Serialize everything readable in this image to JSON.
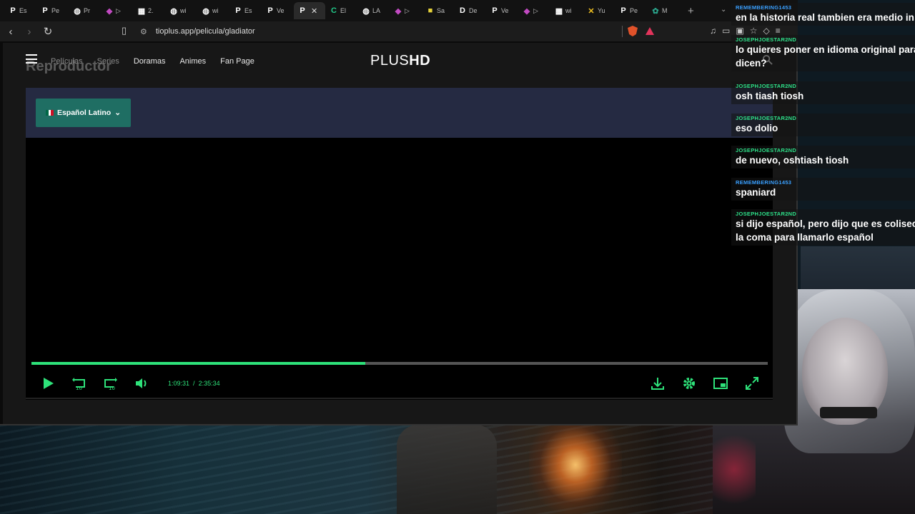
{
  "browser": {
    "tabs": [
      {
        "icon": "P",
        "label": "Es",
        "active": false
      },
      {
        "icon": "P",
        "label": "Pe",
        "active": false
      },
      {
        "icon": "globe",
        "label": "Pr",
        "active": false
      },
      {
        "icon": "twitch",
        "label": "▷",
        "active": false
      },
      {
        "icon": "calc",
        "label": "2.",
        "active": false
      },
      {
        "icon": "globe",
        "label": "wi",
        "active": false
      },
      {
        "icon": "globe",
        "label": "wi",
        "active": false
      },
      {
        "icon": "P",
        "label": "Es",
        "active": false
      },
      {
        "icon": "P",
        "label": "Ve",
        "active": false
      },
      {
        "icon": "P",
        "label": "",
        "active": true
      },
      {
        "icon": "C",
        "label": "El",
        "active": false
      },
      {
        "icon": "globe",
        "label": "LA",
        "active": false
      },
      {
        "icon": "twitch",
        "label": "▷",
        "active": false
      },
      {
        "icon": "note",
        "label": "Sa",
        "active": false
      },
      {
        "icon": "D",
        "label": "De",
        "active": false
      },
      {
        "icon": "P",
        "label": "Ve",
        "active": false
      },
      {
        "icon": "twitch",
        "label": "▷",
        "active": false
      },
      {
        "icon": "img",
        "label": "wi",
        "active": false
      },
      {
        "icon": "yt",
        "label": "Yu",
        "active": false
      },
      {
        "icon": "P",
        "label": "Pe",
        "active": false
      },
      {
        "icon": "gpt",
        "label": "M",
        "active": false
      }
    ],
    "url": "tioplus.app/pelicula/gladiator"
  },
  "site": {
    "logo_light": "PLUS",
    "logo_bold": "HD",
    "page_title": "Reproductor",
    "nav": [
      "Películas",
      "Series",
      "Doramas",
      "Animes",
      "Fan Page"
    ],
    "language_button": "Español Latino",
    "language_flag_colors": [
      "#006847",
      "#ffffff",
      "#ce1126"
    ]
  },
  "player": {
    "current_time": "1:09:31",
    "duration": "2:35:34",
    "time_separator": "/",
    "progress_fraction": 0.453,
    "rewind_seconds": "10",
    "forward_seconds": "10",
    "accent_color": "#2ee27a"
  },
  "chat": [
    {
      "user": "REMEMBERING1453",
      "color": "#3aa0ff",
      "text": [
        "en la historia real tambien era medio in"
      ]
    },
    {
      "user": "JOSEPHJOESTAR2ND",
      "color": "#2ee28a",
      "text": [
        "lo quieres poner en idioma original para",
        "dicen?"
      ]
    },
    {
      "user": "JOSEPHJOESTAR2ND",
      "color": "#2ee28a",
      "text": [
        "osh tiash tiosh"
      ]
    },
    {
      "user": "JOSEPHJOESTAR2ND",
      "color": "#2ee28a",
      "text": [
        "eso dolio"
      ]
    },
    {
      "user": "JOSEPHJOESTAR2ND",
      "color": "#2ee28a",
      "text": [
        "de nuevo, oshtiash tiosh"
      ]
    },
    {
      "user": "REMEMBERING1453",
      "color": "#3aa0ff",
      "text": [
        "spaniard"
      ]
    },
    {
      "user": "JOSEPHJOESTAR2ND",
      "color": "#2ee28a",
      "text": [
        "si dijo español, pero dijo que es coliseo a",
        "la coma para llamarlo español"
      ]
    }
  ]
}
